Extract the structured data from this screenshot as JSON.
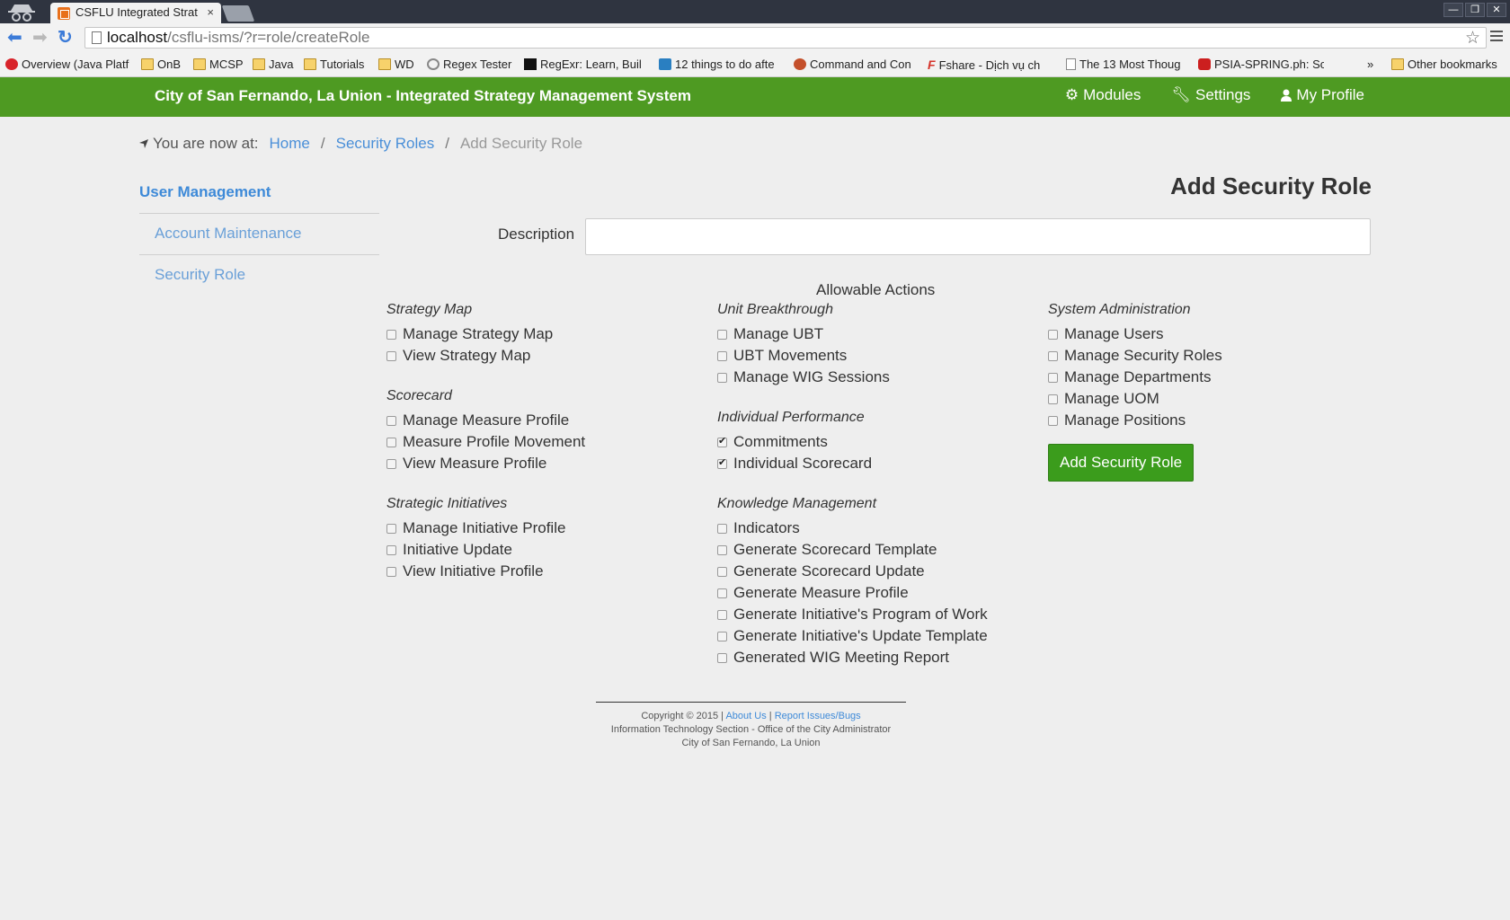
{
  "browser": {
    "tab_title": "CSFLU Integrated Strat",
    "tab_close": "×",
    "url_host": "localhost",
    "url_path": "/csflu-isms/?r=role/createRole",
    "window_buttons": [
      "—",
      "❐",
      "✕"
    ],
    "bookmarks": [
      {
        "label": "Overview (Java Platf",
        "icon": "oracle-icon"
      },
      {
        "label": "OnB",
        "icon": "folder-icon"
      },
      {
        "label": "MCSP",
        "icon": "folder-icon"
      },
      {
        "label": "Java",
        "icon": "folder-icon"
      },
      {
        "label": "Tutorials",
        "icon": "folder-icon"
      },
      {
        "label": "WD",
        "icon": "folder-icon"
      },
      {
        "label": "Regex Tester",
        "icon": "gear-icon"
      },
      {
        "label": "RegExr: Learn, Buil",
        "icon": "regexr-icon"
      },
      {
        "label": "12 things to do afte",
        "icon": "wordpress-icon"
      },
      {
        "label": "Command and Con",
        "icon": "firefox-icon"
      },
      {
        "label": "Fshare - Dịch vụ ch",
        "icon": "fshare-icon"
      },
      {
        "label": "The 13 Most Thoug",
        "icon": "document-icon"
      },
      {
        "label": "PSIA-SPRING.ph: Sc",
        "icon": "youtube-icon"
      }
    ],
    "more_bookmarks": "»",
    "other_bookmarks": "Other bookmarks"
  },
  "app": {
    "brand": "City of San Fernando, La Union - Integrated Strategy Management System",
    "menu": {
      "modules": "Modules",
      "settings": "Settings",
      "profile": "My Profile"
    },
    "breadcrumb": {
      "prefix": "You are now at:",
      "home": "Home",
      "roles": "Security Roles",
      "current": "Add Security Role",
      "sep": "/"
    },
    "sidebar": {
      "heading": "User Management",
      "items": [
        "Account Maintenance",
        "Security Role"
      ]
    },
    "form": {
      "title": "Add Security Role",
      "description_label": "Description",
      "description_value": "",
      "actions_title": "Allowable Actions",
      "submit_label": "Add Security Role",
      "groups": {
        "strategy_map": {
          "title": "Strategy Map",
          "options": [
            {
              "label": "Manage Strategy Map",
              "checked": false
            },
            {
              "label": "View Strategy Map",
              "checked": false
            }
          ]
        },
        "scorecard": {
          "title": "Scorecard",
          "options": [
            {
              "label": "Manage Measure Profile",
              "checked": false
            },
            {
              "label": "Measure Profile Movement",
              "checked": false
            },
            {
              "label": "View Measure Profile",
              "checked": false
            }
          ]
        },
        "strategic_initiatives": {
          "title": "Strategic Initiatives",
          "options": [
            {
              "label": "Manage Initiative Profile",
              "checked": false
            },
            {
              "label": "Initiative Update",
              "checked": false
            },
            {
              "label": "View Initiative Profile",
              "checked": false
            }
          ]
        },
        "unit_breakthrough": {
          "title": "Unit Breakthrough",
          "options": [
            {
              "label": "Manage UBT",
              "checked": false
            },
            {
              "label": "UBT Movements",
              "checked": false
            },
            {
              "label": "Manage WIG Sessions",
              "checked": false
            }
          ]
        },
        "individual_performance": {
          "title": "Individual Performance",
          "options": [
            {
              "label": "Commitments",
              "checked": true
            },
            {
              "label": "Individual Scorecard",
              "checked": true
            }
          ]
        },
        "knowledge_management": {
          "title": "Knowledge Management",
          "options": [
            {
              "label": "Indicators",
              "checked": false
            },
            {
              "label": "Generate Scorecard Template",
              "checked": false
            },
            {
              "label": "Generate Scorecard Update",
              "checked": false
            },
            {
              "label": "Generate Measure Profile",
              "checked": false
            },
            {
              "label": "Generate Initiative's Program of Work",
              "checked": false
            },
            {
              "label": "Generate Initiative's Update Template",
              "checked": false
            },
            {
              "label": "Generated WIG Meeting Report",
              "checked": false
            }
          ]
        },
        "system_administration": {
          "title": "System Administration",
          "options": [
            {
              "label": "Manage Users",
              "checked": false
            },
            {
              "label": "Manage Security Roles",
              "checked": false
            },
            {
              "label": "Manage Departments",
              "checked": false
            },
            {
              "label": "Manage UOM",
              "checked": false
            },
            {
              "label": "Manage Positions",
              "checked": false
            }
          ]
        }
      }
    },
    "footer": {
      "copyright": "Copyright © 2015",
      "sep": "|",
      "about": "About Us",
      "report": "Report Issues/Bugs",
      "line2": "Information Technology Section - Office of the City Administrator",
      "line3": "City of San Fernando, La Union"
    },
    "colors": {
      "navbar": "#4e9a22",
      "button": "#3b9c1c",
      "link": "#4a8fd8"
    }
  }
}
